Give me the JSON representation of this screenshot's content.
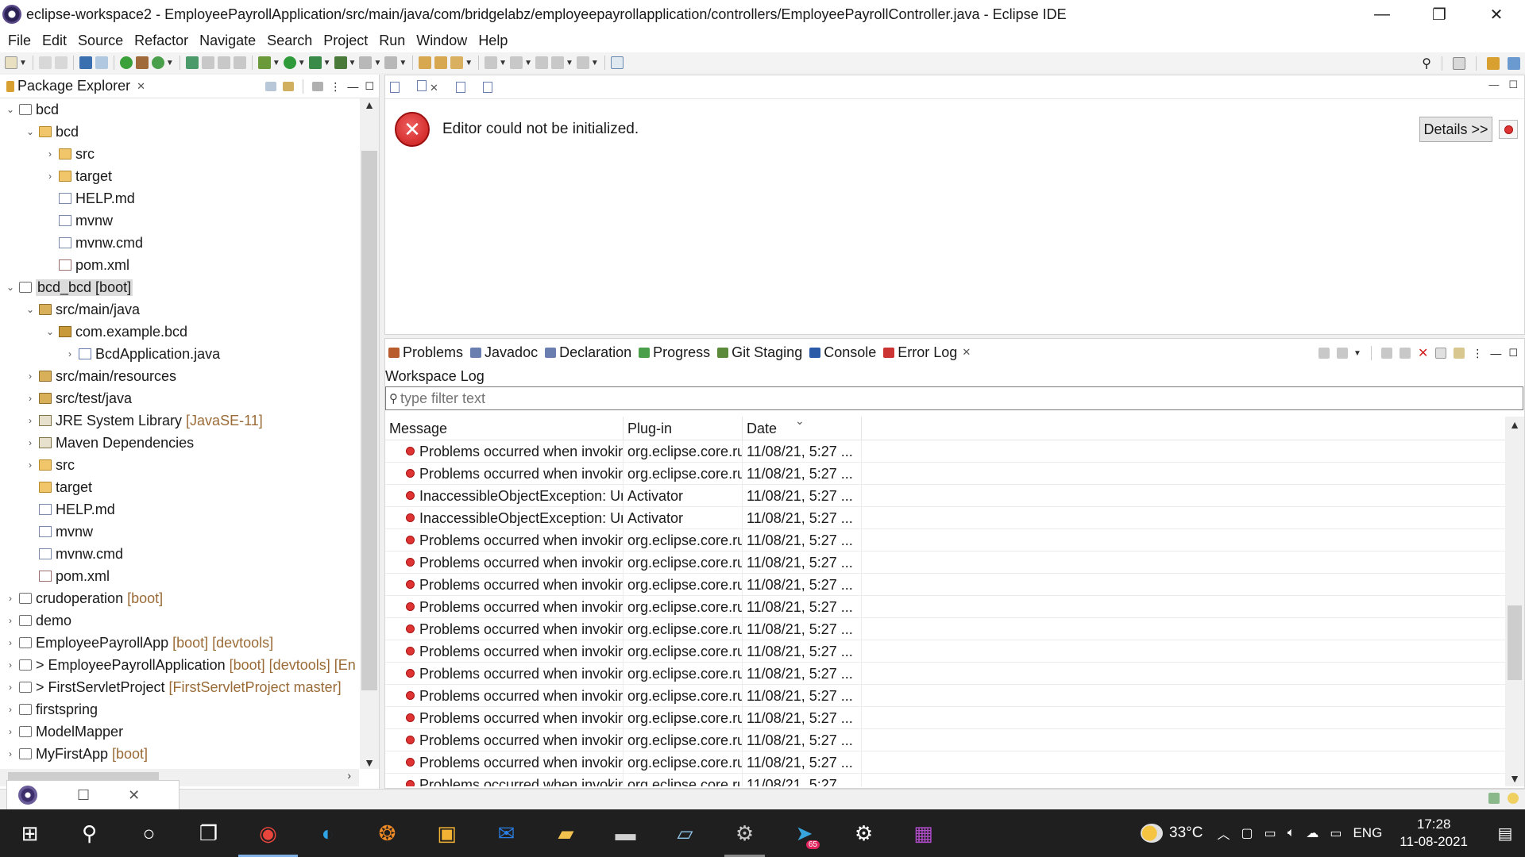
{
  "window": {
    "title": "eclipse-workspace2 - EmployeePayrollApplication/src/main/java/com/bridgelabz/employeepayrollapplication/controllers/EmployeePayrollController.java - Eclipse IDE",
    "minimize": "—",
    "restore": "❐",
    "close": "✕"
  },
  "menu": [
    "File",
    "Edit",
    "Source",
    "Refactor",
    "Navigate",
    "Search",
    "Project",
    "Run",
    "Window",
    "Help"
  ],
  "package_explorer": {
    "title": "Package Explorer",
    "close": "✕",
    "tree": [
      {
        "twist": "⌄",
        "indent": 0,
        "icon": "project",
        "name": "bcd",
        "deco": ""
      },
      {
        "twist": "⌄",
        "indent": 1,
        "icon": "folder",
        "name": "bcd",
        "deco": ""
      },
      {
        "twist": "›",
        "indent": 2,
        "icon": "folder",
        "name": "src",
        "deco": ""
      },
      {
        "twist": "›",
        "indent": 2,
        "icon": "folder",
        "name": "target",
        "deco": ""
      },
      {
        "twist": "",
        "indent": 2,
        "icon": "file",
        "name": "HELP.md",
        "deco": ""
      },
      {
        "twist": "",
        "indent": 2,
        "icon": "file",
        "name": "mvnw",
        "deco": ""
      },
      {
        "twist": "",
        "indent": 2,
        "icon": "file",
        "name": "mvnw.cmd",
        "deco": ""
      },
      {
        "twist": "",
        "indent": 2,
        "icon": "xml",
        "name": "pom.xml",
        "deco": ""
      },
      {
        "twist": "⌄",
        "indent": 0,
        "icon": "project",
        "name": "bcd_bcd [boot]",
        "deco": "",
        "selected": true
      },
      {
        "twist": "⌄",
        "indent": 1,
        "icon": "srcfolder",
        "name": "src/main/java",
        "deco": ""
      },
      {
        "twist": "⌄",
        "indent": 2,
        "icon": "package",
        "name": "com.example.bcd",
        "deco": ""
      },
      {
        "twist": "›",
        "indent": 3,
        "icon": "java",
        "name": "BcdApplication.java",
        "deco": ""
      },
      {
        "twist": "›",
        "indent": 1,
        "icon": "srcfolder",
        "name": "src/main/resources",
        "deco": ""
      },
      {
        "twist": "›",
        "indent": 1,
        "icon": "srcfolder",
        "name": "src/test/java",
        "deco": ""
      },
      {
        "twist": "›",
        "indent": 1,
        "icon": "lib",
        "name": "JRE System Library",
        "deco": "[JavaSE-11]"
      },
      {
        "twist": "›",
        "indent": 1,
        "icon": "lib",
        "name": "Maven Dependencies",
        "deco": ""
      },
      {
        "twist": "›",
        "indent": 1,
        "icon": "folder",
        "name": "src",
        "deco": ""
      },
      {
        "twist": "",
        "indent": 1,
        "icon": "folder",
        "name": "target",
        "deco": ""
      },
      {
        "twist": "",
        "indent": 1,
        "icon": "file",
        "name": "HELP.md",
        "deco": ""
      },
      {
        "twist": "",
        "indent": 1,
        "icon": "file",
        "name": "mvnw",
        "deco": ""
      },
      {
        "twist": "",
        "indent": 1,
        "icon": "file",
        "name": "mvnw.cmd",
        "deco": ""
      },
      {
        "twist": "",
        "indent": 1,
        "icon": "xml",
        "name": "pom.xml",
        "deco": ""
      },
      {
        "twist": "›",
        "indent": 0,
        "icon": "project",
        "name": "crudoperation",
        "deco": "[boot]"
      },
      {
        "twist": "›",
        "indent": 0,
        "icon": "project",
        "name": "demo",
        "deco": ""
      },
      {
        "twist": "›",
        "indent": 0,
        "icon": "project",
        "name": "EmployeePayrollApp",
        "deco": "[boot] [devtools]"
      },
      {
        "twist": "›",
        "indent": 0,
        "icon": "project",
        "name": "> EmployeePayrollApplication",
        "deco": "[boot] [devtools] [En"
      },
      {
        "twist": "›",
        "indent": 0,
        "icon": "project",
        "name": "> FirstServletProject",
        "deco": "[FirstServletProject master]"
      },
      {
        "twist": "›",
        "indent": 0,
        "icon": "project",
        "name": "firstspring",
        "deco": ""
      },
      {
        "twist": "›",
        "indent": 0,
        "icon": "project",
        "name": "ModelMapper",
        "deco": ""
      },
      {
        "twist": "›",
        "indent": 0,
        "icon": "project",
        "name": "MyFirstApp",
        "deco": "[boot]"
      }
    ]
  },
  "editor": {
    "error_message": "Editor could not be initialized.",
    "details_button": "Details >>",
    "tab_close": "✕"
  },
  "bottom_panel": {
    "tabs": [
      {
        "label": "Problems",
        "color": "#b85c2e"
      },
      {
        "label": "Javadoc",
        "color": "#6a7fb0"
      },
      {
        "label": "Declaration",
        "color": "#6a7fb0"
      },
      {
        "label": "Progress",
        "color": "#4aa04a"
      },
      {
        "label": "Git Staging",
        "color": "#5a8a3a"
      },
      {
        "label": "Console",
        "color": "#2a5aa8"
      },
      {
        "label": "Error Log",
        "color": "#cc3333",
        "active": true
      }
    ],
    "tab_close": "✕",
    "workspace_label": "Workspace Log",
    "filter_placeholder": "type filter text",
    "columns": {
      "message": "Message",
      "plugin": "Plug-in",
      "date": "Date",
      "sort_indicator": "⌄"
    },
    "rows": [
      {
        "message": "Problems occurred when invoking code from plug-in",
        "plugin": "org.eclipse.core.runtime",
        "date": "11/08/21, 5:27 ..."
      },
      {
        "message": "Problems occurred when invoking code from plug-in",
        "plugin": "org.eclipse.core.runtime",
        "date": "11/08/21, 5:27 ..."
      },
      {
        "message": "InaccessibleObjectException: Unable to make field",
        "plugin": "Activator",
        "date": "11/08/21, 5:27 ..."
      },
      {
        "message": "InaccessibleObjectException: Unable to make field",
        "plugin": "Activator",
        "date": "11/08/21, 5:27 ..."
      },
      {
        "message": "Problems occurred when invoking code from plug-in",
        "plugin": "org.eclipse.core.runtime",
        "date": "11/08/21, 5:27 ..."
      },
      {
        "message": "Problems occurred when invoking code from plug-in",
        "plugin": "org.eclipse.core.runtime",
        "date": "11/08/21, 5:27 ..."
      },
      {
        "message": "Problems occurred when invoking code from plug-in",
        "plugin": "org.eclipse.core.runtime",
        "date": "11/08/21, 5:27 ..."
      },
      {
        "message": "Problems occurred when invoking code from plug-in",
        "plugin": "org.eclipse.core.runtime",
        "date": "11/08/21, 5:27 ..."
      },
      {
        "message": "Problems occurred when invoking code from plug-in",
        "plugin": "org.eclipse.core.runtime",
        "date": "11/08/21, 5:27 ..."
      },
      {
        "message": "Problems occurred when invoking code from plug-in",
        "plugin": "org.eclipse.core.runtime",
        "date": "11/08/21, 5:27 ..."
      },
      {
        "message": "Problems occurred when invoking code from plug-in",
        "plugin": "org.eclipse.core.runtime",
        "date": "11/08/21, 5:27 ..."
      },
      {
        "message": "Problems occurred when invoking code from plug-in",
        "plugin": "org.eclipse.core.runtime",
        "date": "11/08/21, 5:27 ..."
      },
      {
        "message": "Problems occurred when invoking code from plug-in",
        "plugin": "org.eclipse.core.runtime",
        "date": "11/08/21, 5:27 ..."
      },
      {
        "message": "Problems occurred when invoking code from plug-in",
        "plugin": "org.eclipse.core.runtime",
        "date": "11/08/21, 5:27 ..."
      },
      {
        "message": "Problems occurred when invoking code from plug-in",
        "plugin": "org.eclipse.core.runtime",
        "date": "11/08/21, 5:27 ..."
      },
      {
        "message": "Problems occurred when invoking code from plug-in",
        "plugin": "org.eclipse.core.runtime",
        "date": "11/08/21, 5:27"
      }
    ]
  },
  "mini_window": {
    "restore": "☐",
    "close": "✕"
  },
  "taskbar": {
    "apps": [
      {
        "name": "start",
        "glyph": "⊞"
      },
      {
        "name": "search",
        "glyph": "⚲"
      },
      {
        "name": "cortana",
        "glyph": "○"
      },
      {
        "name": "task-view",
        "glyph": "❐"
      },
      {
        "name": "chrome",
        "glyph": "◉",
        "color": "#e8453c",
        "state": "active"
      },
      {
        "name": "edge",
        "glyph": "◐",
        "color": "#2fa4e7"
      },
      {
        "name": "photos-app",
        "glyph": "❂",
        "color": "#f08a24"
      },
      {
        "name": "store",
        "glyph": "▣",
        "color": "#f2b233"
      },
      {
        "name": "mail",
        "glyph": "✉",
        "color": "#2a7de1"
      },
      {
        "name": "file-explorer",
        "glyph": "▰",
        "color": "#f2c14e"
      },
      {
        "name": "terminal",
        "glyph": "▬",
        "color": "#d0d0d0"
      },
      {
        "name": "notepad",
        "glyph": "▱",
        "color": "#8ec5e8"
      },
      {
        "name": "eclipse",
        "glyph": "⚙",
        "color": "#c8c8c8",
        "state": "running"
      },
      {
        "name": "telegram",
        "glyph": "➤",
        "color": "#37a6de",
        "badge": "65"
      },
      {
        "name": "settings",
        "glyph": "⚙",
        "color": "#ffffff"
      },
      {
        "name": "winrar",
        "glyph": "▦",
        "color": "#b04cc9"
      }
    ],
    "temperature": "33°C",
    "language": "ENG",
    "time": "17:28",
    "date": "11-08-2021"
  }
}
